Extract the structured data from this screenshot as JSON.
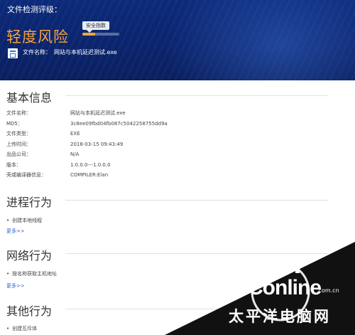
{
  "header": {
    "label": "文件检测评级：",
    "risk_level": "轻度风险",
    "safety_badge": "安全指数",
    "safety_fill": 0.35,
    "file_label": "文件名称：",
    "file_name": "网站与本机延迟测试.exe"
  },
  "basic_info": {
    "title": "基本信息",
    "rows": [
      {
        "key": "文件名称：",
        "value": "网站与本机延迟测试.exe"
      },
      {
        "key": "MD5：",
        "value": "3c8ee09fbd04fb087c5042258755dd9a"
      },
      {
        "key": "文件类型：",
        "value": "EXE"
      },
      {
        "key": "上传时间：",
        "value": "2018-03-15 09:43:49"
      },
      {
        "key": "出品公司：",
        "value": "N/A"
      },
      {
        "key": "版本：",
        "value": "1.0.0.0---1.0.0.0"
      },
      {
        "key": "壳或编译器信息：",
        "value": "COMPILER:Elan"
      }
    ]
  },
  "process": {
    "title": "进程行为",
    "items": [
      "创建本地线程"
    ],
    "more": "更多>>"
  },
  "network": {
    "title": "网络行为",
    "items": [
      "按名称获取主机地址"
    ],
    "more": "更多>>"
  },
  "other": {
    "title": "其他行为",
    "items": [
      "创建互斥体"
    ]
  },
  "watermark": {
    "logo": "PConline",
    "domain": ".com.cn",
    "chinese": "太平洋电脑网"
  },
  "colors": {
    "header_bg": "#0b246c",
    "risk": "#f7a23a",
    "link": "#2f63c8"
  }
}
